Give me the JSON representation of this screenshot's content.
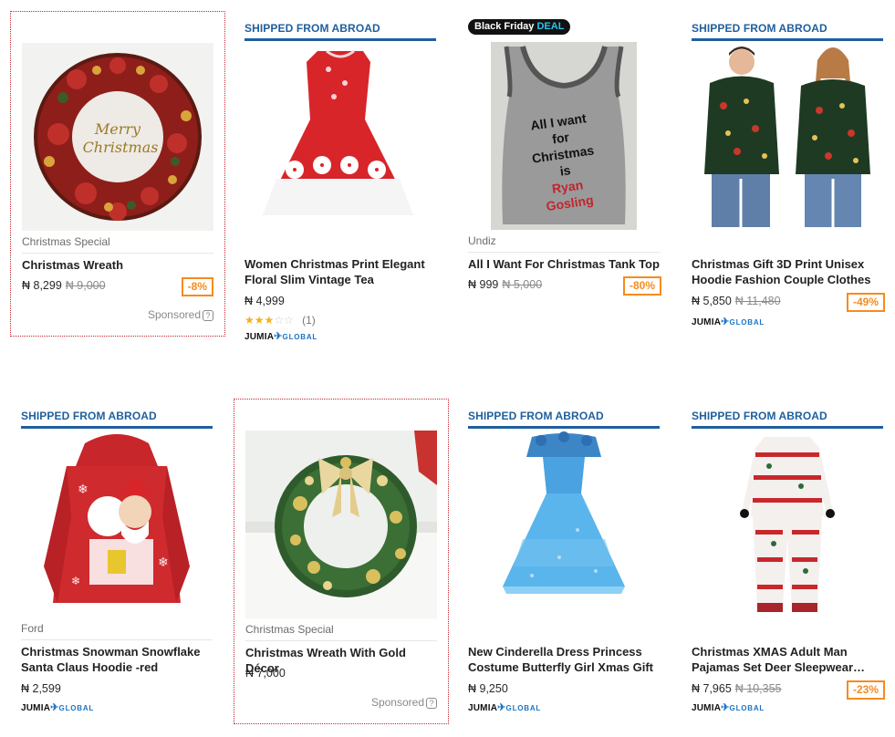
{
  "products": [
    {
      "badge_text": "",
      "deal": null,
      "brand": "Christmas Special",
      "name": "Christmas Wreath",
      "price": "₦ 8,299",
      "old_price": "₦ 9,000",
      "discount": "-8%",
      "sponsored": "Sponsored",
      "rating": null,
      "seller_logo": null,
      "image": "wreath-red"
    },
    {
      "badge_text": "SHIPPED FROM ABROAD",
      "deal": null,
      "brand": "",
      "name": "Women Christmas Print Elegant Floral Slim Vintage Tea Hepburn…",
      "price": "₦ 4,999",
      "old_price": "",
      "discount": "",
      "sponsored": "",
      "rating": {
        "stars": 3,
        "count": "(1)"
      },
      "seller_logo": {
        "main": "JUMIA",
        "sub": "GLOBAL"
      },
      "image": "red-dress"
    },
    {
      "badge_text": "",
      "deal": {
        "prefix": "Black Friday",
        "highlight": "DEAL"
      },
      "brand": "Undiz",
      "name": "All I Want For Christmas Tank Top",
      "price": "₦ 999",
      "old_price": "₦ 5,000",
      "discount": "-80%",
      "sponsored": "",
      "rating": null,
      "seller_logo": null,
      "image": "tank-top",
      "image_text": [
        "All I want",
        "for",
        "Christmas",
        "is",
        "Ryan",
        "Gosling"
      ]
    },
    {
      "badge_text": "SHIPPED FROM ABROAD",
      "deal": null,
      "brand": "",
      "name": "Christmas Gift 3D Print Unisex Hoodie Fashion Couple Clothes",
      "price": "₦ 5,850",
      "old_price": "₦ 11,480",
      "discount": "-49%",
      "sponsored": "",
      "rating": null,
      "seller_logo": {
        "main": "JUMIA",
        "sub": "GLOBAL"
      },
      "image": "couple-hoodies"
    },
    {
      "badge_text": "SHIPPED FROM ABROAD",
      "deal": null,
      "brand": "Ford",
      "name": "Christmas Snowman Snowflake Santa Claus Hoodie -red",
      "price": "₦ 2,599",
      "old_price": "",
      "discount": "",
      "sponsored": "",
      "rating": null,
      "seller_logo": {
        "main": "JUMIA",
        "sub": "GLOBAL"
      },
      "image": "red-hoodie"
    },
    {
      "badge_text": "",
      "deal": null,
      "brand": "Christmas Special",
      "name": "Christmas Wreath With Gold Décor",
      "price": "₦ 7,000",
      "old_price": "",
      "discount": "",
      "sponsored": "Sponsored",
      "rating": null,
      "seller_logo": null,
      "image": "wreath-gold"
    },
    {
      "badge_text": "SHIPPED FROM ABROAD",
      "deal": null,
      "brand": "",
      "name": "New Cinderella Dress Princess Costume Butterfly Girl Xmas Gift",
      "price": "₦ 9,250",
      "old_price": "",
      "discount": "",
      "sponsored": "",
      "rating": null,
      "seller_logo": {
        "main": "JUMIA",
        "sub": "GLOBAL"
      },
      "image": "blue-dress"
    },
    {
      "badge_text": "SHIPPED FROM ABROAD",
      "deal": null,
      "brand": "",
      "name": "Christmas XMAS Adult Man Pajamas Set Deer Sleepwear…",
      "price": "₦ 7,965",
      "old_price": "₦ 10,355",
      "discount": "-23%",
      "sponsored": "",
      "rating": null,
      "seller_logo": {
        "main": "JUMIA",
        "sub": "GLOBAL"
      },
      "image": "pajamas"
    }
  ],
  "colors": {
    "badge_blue": "#1f5f9e",
    "discount_orange": "#f68b1e",
    "sponsored_border": "#c0262c",
    "star": "#f6b01e"
  }
}
